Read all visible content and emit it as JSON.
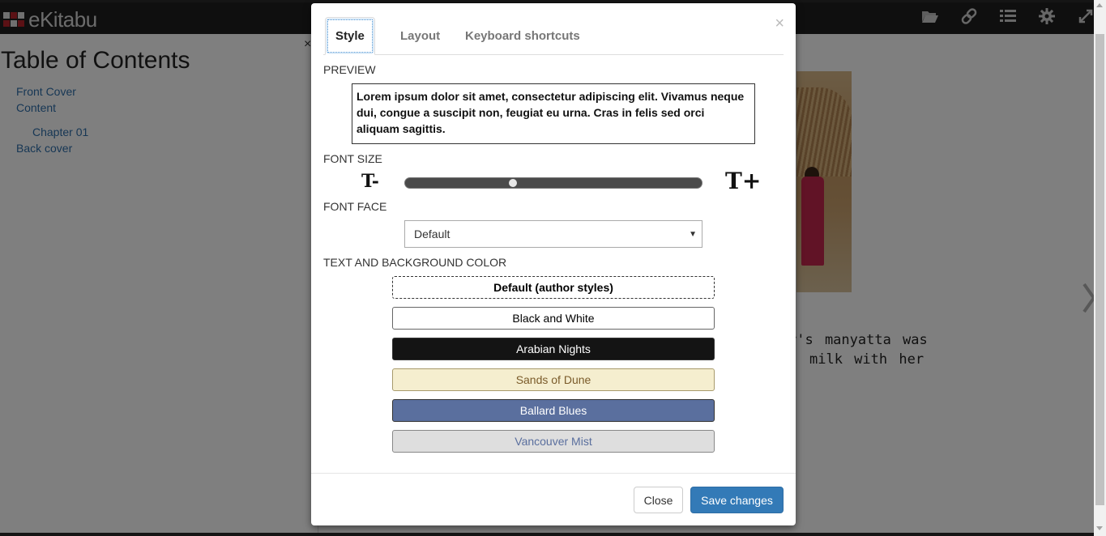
{
  "app": {
    "logo_text": "eKitabu",
    "toolbar_icons": [
      "folder-open-icon",
      "link-icon",
      "list-icon",
      "gear-icon",
      "fullscreen-icon"
    ]
  },
  "toc": {
    "title": "Table of Contents",
    "close_glyph": "×",
    "items": [
      {
        "label": "Front Cover",
        "level": 1
      },
      {
        "label": "Content",
        "level": 1
      },
      {
        "label": "Chapter 01",
        "level": 2
      },
      {
        "label": "Back cover",
        "level": 1
      }
    ]
  },
  "book": {
    "line1": "r's manyatta was",
    "line2": "milk with her"
  },
  "modal": {
    "close_glyph": "×",
    "tabs": [
      {
        "label": "Style",
        "active": true
      },
      {
        "label": "Layout",
        "active": false
      },
      {
        "label": "Keyboard shortcuts",
        "active": false
      }
    ],
    "preview": {
      "label": "PREVIEW",
      "text": "Lorem ipsum dolor sit amet, consectetur adipiscing elit. Vivamus neque dui, congue a suscipit non, feugiat eu urna. Cras in felis sed orci aliquam sagittis."
    },
    "font_size": {
      "label": "FONT SIZE",
      "decrease_glyph": "T-",
      "increase_glyph": "T+",
      "slider_fraction": 0.36
    },
    "font_face": {
      "label": "FONT FACE",
      "selected": "Default"
    },
    "colors": {
      "label": "TEXT AND BACKGROUND COLOR",
      "themes": [
        {
          "label": "Default (author styles)",
          "bg": "#ffffff",
          "fg": "#000000",
          "selected": true
        },
        {
          "label": "Black and White",
          "bg": "#ffffff",
          "fg": "#000000",
          "selected": false
        },
        {
          "label": "Arabian Nights",
          "bg": "#141414",
          "fg": "#ffffff",
          "selected": false
        },
        {
          "label": "Sands of Dune",
          "bg": "#f5eecf",
          "fg": "#7a5b2a",
          "selected": false
        },
        {
          "label": "Ballard Blues",
          "bg": "#5a6f9e",
          "fg": "#ffffff",
          "selected": false
        },
        {
          "label": "Vancouver Mist",
          "bg": "#dedede",
          "fg": "#5a6f9e",
          "selected": false
        }
      ]
    },
    "footer": {
      "close_label": "Close",
      "save_label": "Save changes"
    }
  },
  "colors": {
    "topbar": "#1f1f1f",
    "link": "#2f6fab",
    "primary": "#337ab7"
  }
}
